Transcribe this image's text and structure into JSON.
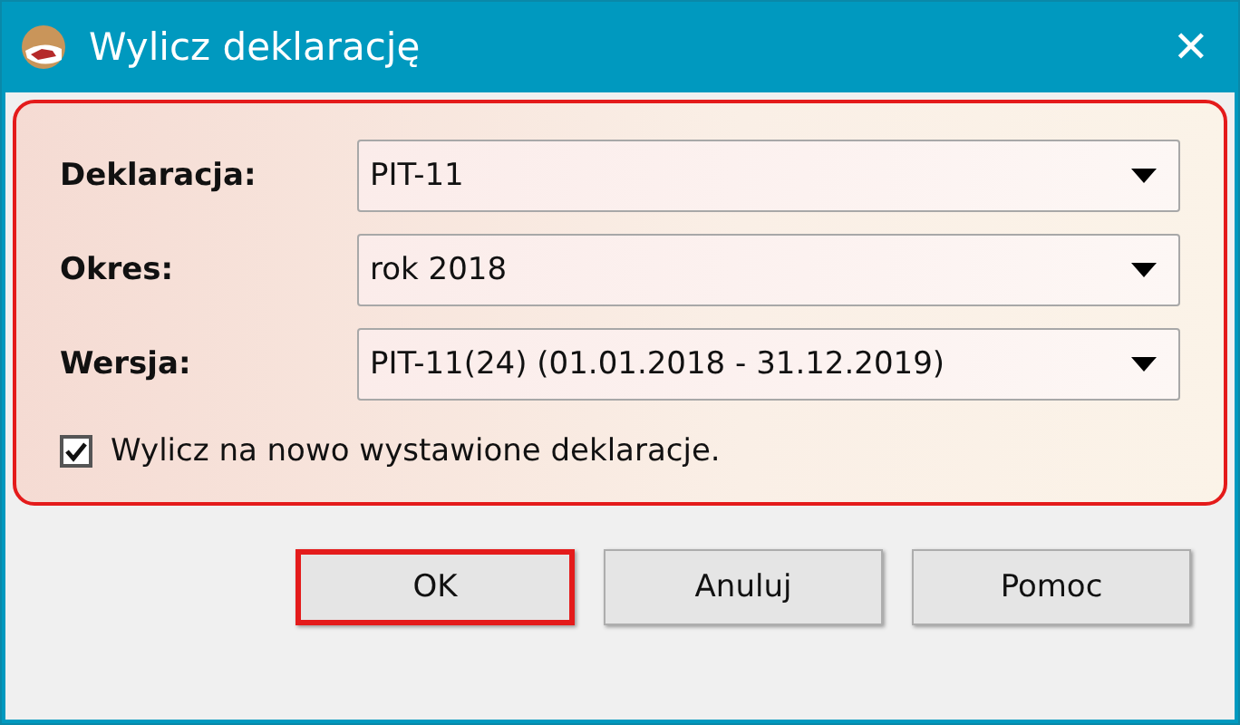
{
  "window": {
    "title": "Wylicz deklarację",
    "close": "✕"
  },
  "fields": [
    {
      "label": "Deklaracja:",
      "value": "PIT-11"
    },
    {
      "label": "Okres:",
      "value": "rok 2018"
    },
    {
      "label": "Wersja:",
      "value": "PIT-11(24) (01.01.2018 - 31.12.2019)"
    }
  ],
  "checkbox": {
    "label": "Wylicz na nowo wystawione deklaracje.",
    "checked": true
  },
  "panel_highlighted": true,
  "buttons": [
    {
      "label": "OK",
      "highlighted": true
    },
    {
      "label": "Anuluj",
      "highlighted": false
    },
    {
      "label": "Pomoc",
      "highlighted": false
    }
  ]
}
